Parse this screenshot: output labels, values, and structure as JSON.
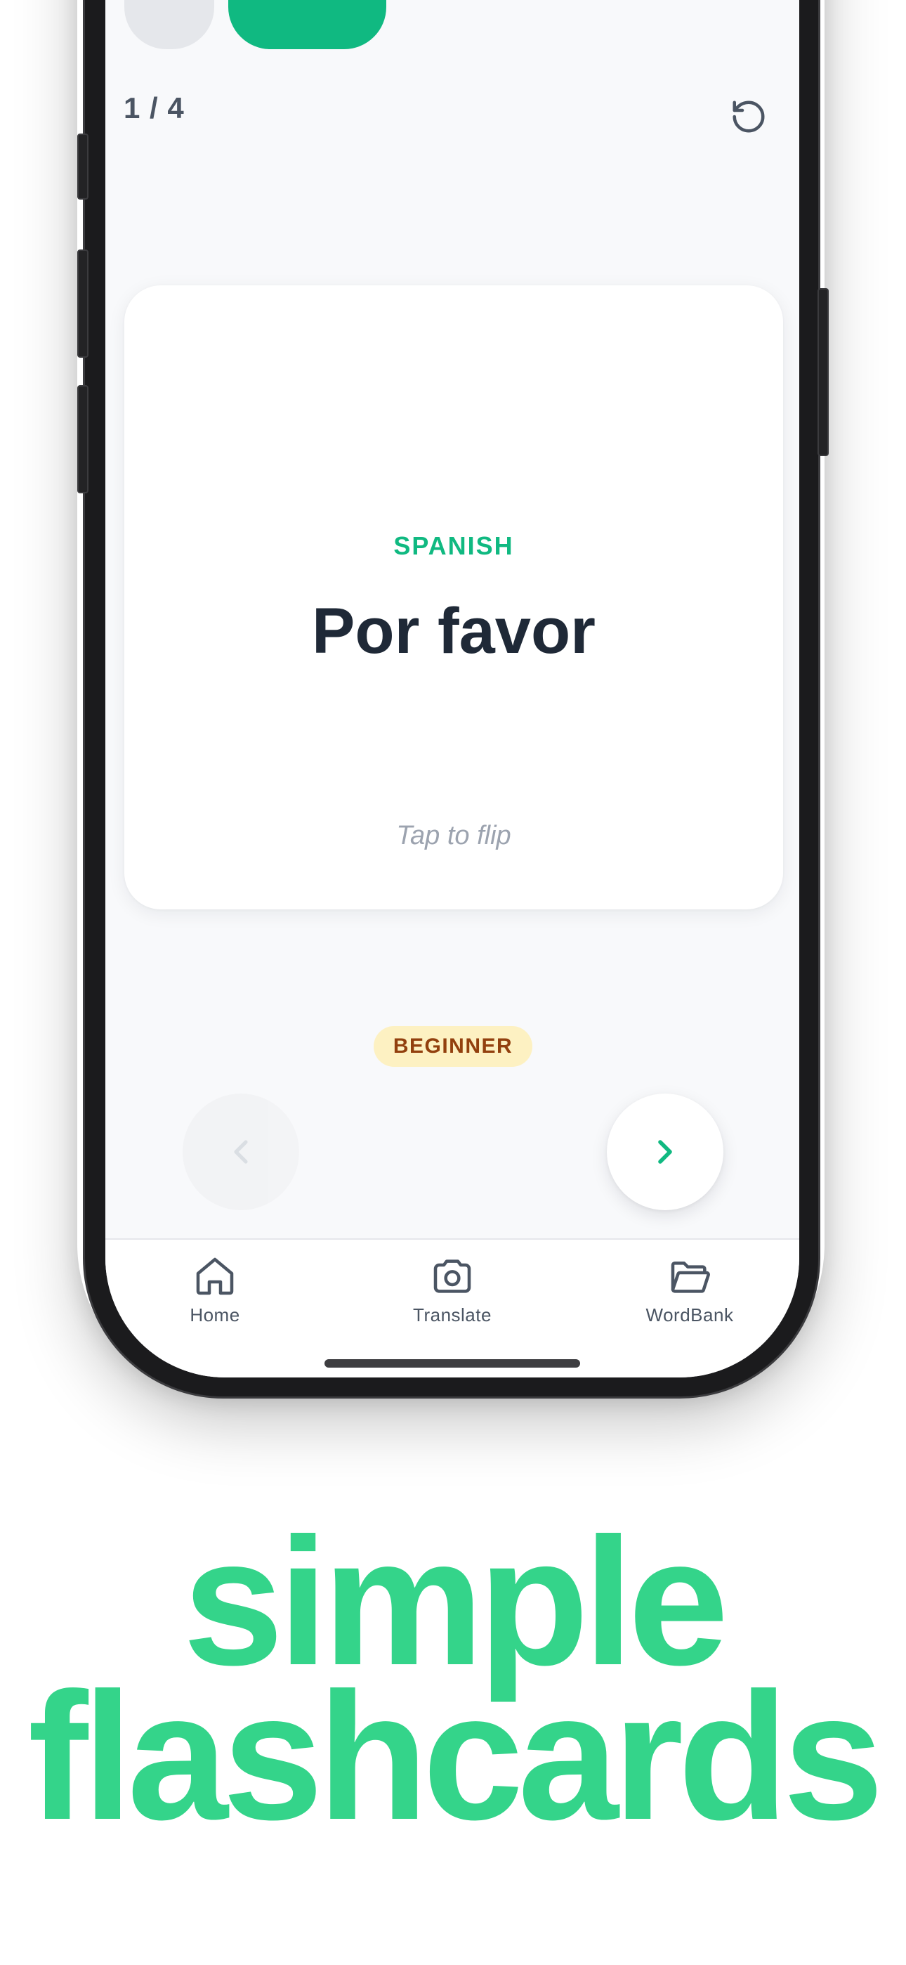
{
  "colors": {
    "accent": "#10b981",
    "headline": "#34d48a",
    "title": "#1f2937",
    "muted": "#9ca3af",
    "badge_bg": "#fdf1c2",
    "badge_text": "#92400e"
  },
  "progress": {
    "counter": "1 / 4",
    "current": 1,
    "total": 4
  },
  "toolbar": {
    "reset_icon": "rotate-ccw-icon"
  },
  "card": {
    "language": "SPANISH",
    "word": "Por favor",
    "hint": "Tap to flip"
  },
  "level": "BEGINNER",
  "navigation": {
    "prev_icon": "chevron-left-icon",
    "next_icon": "chevron-right-icon",
    "prev_enabled": false
  },
  "tabbar": {
    "items": [
      {
        "label": "Home",
        "icon": "home-icon"
      },
      {
        "label": "Translate",
        "icon": "camera-icon"
      },
      {
        "label": "WordBank",
        "icon": "folder-open-icon"
      }
    ]
  },
  "headline": {
    "line1": "simple",
    "line2": "flashcards"
  }
}
